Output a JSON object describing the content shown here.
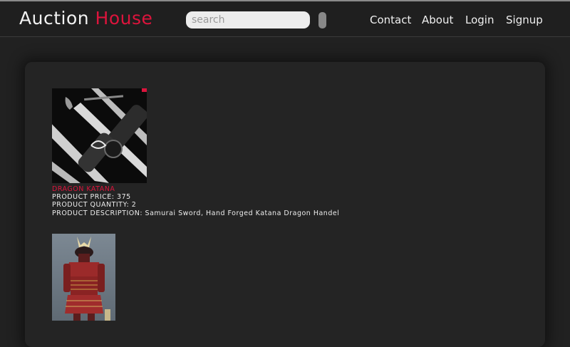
{
  "header": {
    "brand_part1": "Auction",
    "brand_part2": "House",
    "search_placeholder": "search",
    "nav": [
      "Contact",
      "About",
      "Login",
      "Signup"
    ]
  },
  "products": [
    {
      "name": "DRAGON KATANA",
      "price_line": "PRODUCT PRICE: 375",
      "quantity_line": "PRODUCT QUANTITY: 2",
      "description_line": "PRODUCT DESCRIPTION: Samurai Sword, Hand Forged Katana Dragon Handel",
      "image": "katana-photo"
    },
    {
      "image": "samurai-armor-photo"
    }
  ],
  "colors": {
    "accent": "#dc143c",
    "background": "#212121",
    "panel": "#242424"
  }
}
